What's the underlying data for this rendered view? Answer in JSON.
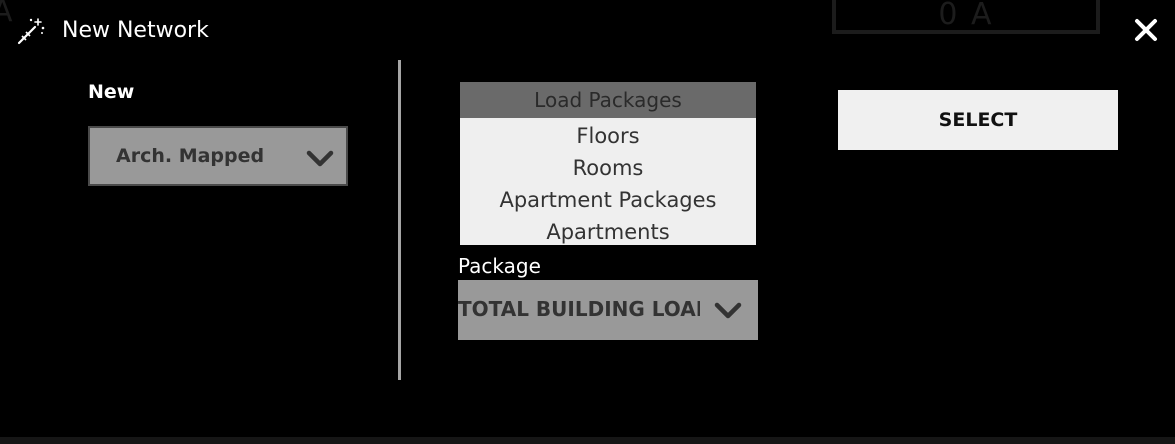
{
  "background": {
    "top_box_text": "0 A",
    "left_edge_glyph": "A"
  },
  "titlebar": {
    "title": "New Network",
    "icon": "magic-wand-icon",
    "close_icon": "close-icon"
  },
  "left_panel": {
    "new_label": "New",
    "network_type_dropdown": {
      "selected": "Arch. Mapped",
      "icon": "chevron-down-icon"
    }
  },
  "load_packages": {
    "header": "Load Packages",
    "items": [
      "Floors",
      "Rooms",
      "Apartment Packages",
      "Apartments"
    ]
  },
  "package": {
    "label": "Package",
    "selected": "TOTAL BUILDING LOAD",
    "icon": "chevron-down-icon"
  },
  "select_button": {
    "label": "SELECT"
  },
  "colors": {
    "background": "#000000",
    "dropdown_bg": "#999999",
    "list_bg": "#efefef",
    "list_header_bg": "#6a6a6a",
    "button_bg": "#f0f0f0",
    "divider": "#a6a6a6"
  }
}
